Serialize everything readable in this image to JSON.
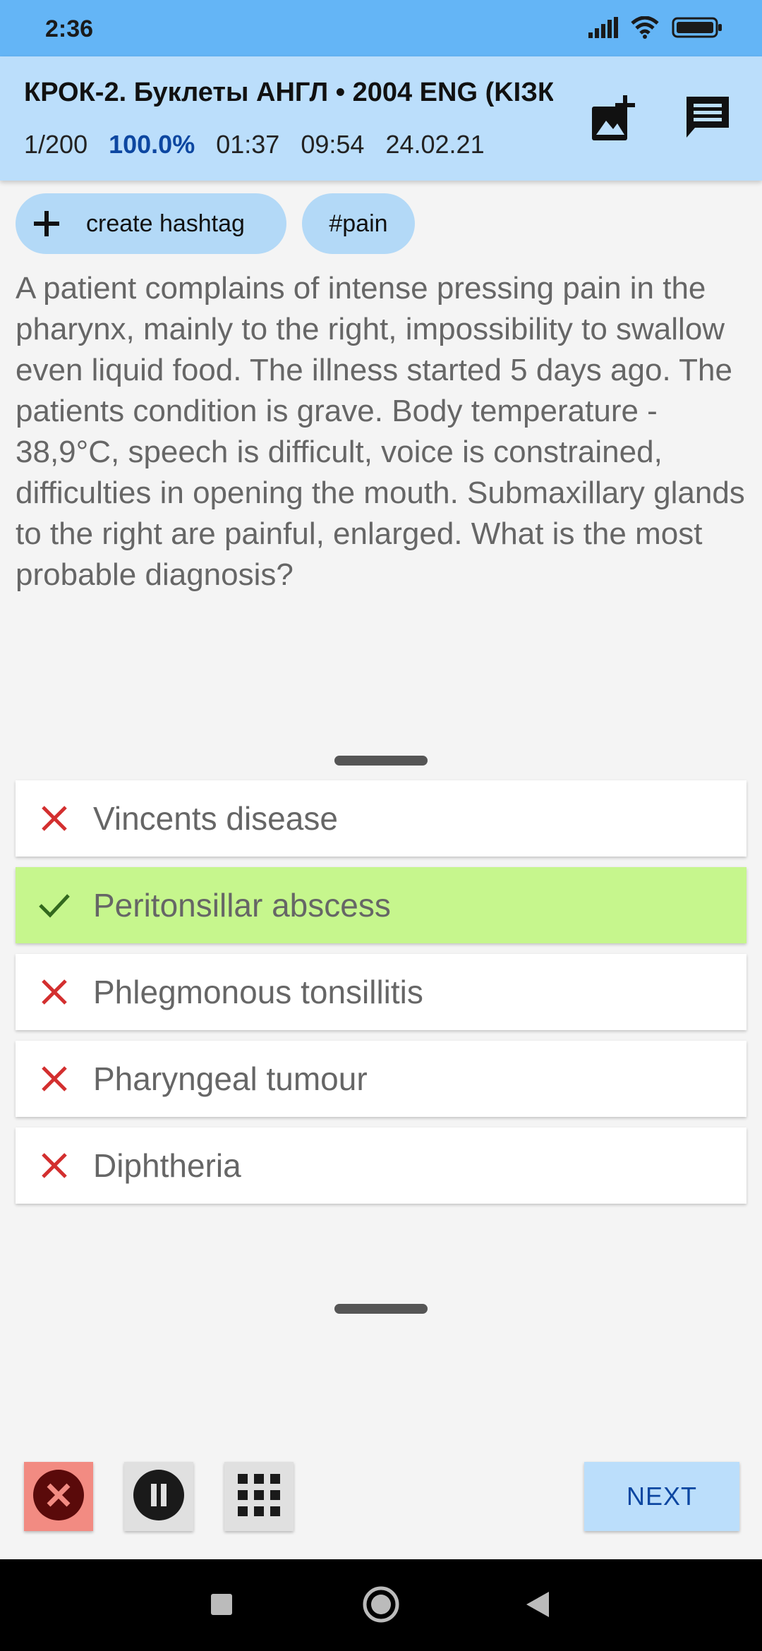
{
  "status_bar": {
    "time": "2:36",
    "icons": [
      "signal-icon",
      "wifi-icon",
      "battery-icon"
    ]
  },
  "header": {
    "title": "КРОК-2. Буклеты АНГЛ • 2004 ENG (KIЗК",
    "progress": "1/200",
    "percent": "100.0%",
    "timer_elapsed": "01:37",
    "clock": "09:54",
    "date": "24.02.21",
    "actions": [
      "add-image-icon",
      "comment-icon"
    ]
  },
  "hashtags": {
    "create_label": "create hashtag",
    "tags": [
      "#pain"
    ]
  },
  "question": {
    "text": "A patient complains of intense pressing pain in the pharynx, mainly to the right, impossibility to swallow even liquid food. The illness started 5 days ago. The patients condition is grave. Body temperature - 38,9°C, speech is difficult, voice is constrained, difficulties in opening the mouth. Submaxillary glands to the right are painful, enlarged. What is the most probable diagnosis?"
  },
  "answers": [
    {
      "label": "Vincents disease",
      "correct": false
    },
    {
      "label": "Peritonsillar abscess",
      "correct": true
    },
    {
      "label": "Phlegmonous tonsillitis",
      "correct": false
    },
    {
      "label": "Pharyngeal tumour",
      "correct": false
    },
    {
      "label": "Diphtheria",
      "correct": false
    }
  ],
  "bottom": {
    "next_label": "NEXT",
    "buttons": [
      "close-icon",
      "pause-icon",
      "grid-icon"
    ]
  },
  "colors": {
    "status_bar": "#64b5f6",
    "header": "#bbdefb",
    "correct_answer": "#c6f68d",
    "wrong_mark": "#d32f2f",
    "correct_mark": "#33691e",
    "percent": "#0d47a1",
    "close_button": "#f28b82"
  }
}
